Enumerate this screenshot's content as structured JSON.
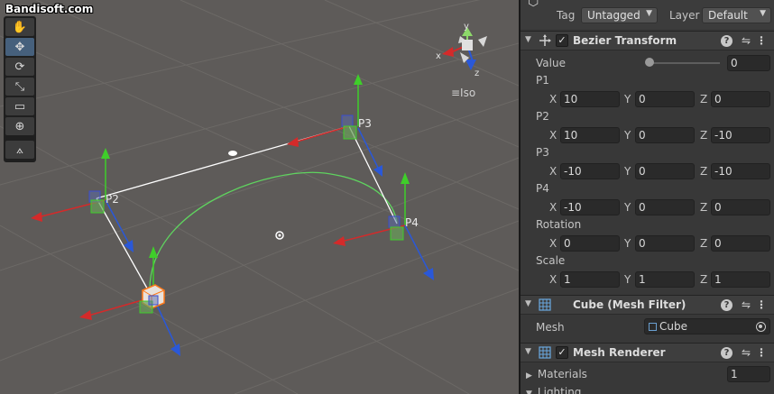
{
  "watermark": "Bandisoft.com",
  "scene": {
    "tools": [
      {
        "name": "hand-tool",
        "glyph": "✋"
      },
      {
        "name": "move-tool",
        "glyph": "✥"
      },
      {
        "name": "rotate-tool",
        "glyph": "⟳"
      },
      {
        "name": "scale-tool",
        "glyph": "⤡"
      },
      {
        "name": "rect-tool",
        "glyph": "▭"
      },
      {
        "name": "transform-tool",
        "glyph": "⊕"
      },
      {
        "name": "custom-tool",
        "glyph": "⟑"
      }
    ],
    "active_tool": 1,
    "gizmo": {
      "y_label": "y",
      "x_label": "x",
      "z_label": "z"
    },
    "projection_label": "≡Iso",
    "point_labels": {
      "p2": "P2",
      "p3": "P3",
      "p4": "P4"
    },
    "colors": {
      "curve": "#5fd35f",
      "handle": "#ffffff",
      "x_axis": "#d42a2a",
      "y_axis": "#3fce2a",
      "z_axis": "#2a58d8"
    }
  },
  "inspector": {
    "tag_label": "Tag",
    "tag_value": "Untagged",
    "layer_label": "Layer",
    "layer_value": "Default",
    "bezier": {
      "title": "Bezier Transform",
      "value_label": "Value",
      "value": "0",
      "p1_label": "P1",
      "p1": {
        "x": "10",
        "y": "0",
        "z": "0"
      },
      "p2_label": "P2",
      "p2": {
        "x": "10",
        "y": "0",
        "z": "-10"
      },
      "p3_label": "P3",
      "p3": {
        "x": "-10",
        "y": "0",
        "z": "-10"
      },
      "p4_label": "P4",
      "p4": {
        "x": "-10",
        "y": "0",
        "z": "0"
      },
      "rotation_label": "Rotation",
      "rotation": {
        "x": "0",
        "y": "0",
        "z": "0"
      },
      "scale_label": "Scale",
      "scale": {
        "x": "1",
        "y": "1",
        "z": "1"
      }
    },
    "axis_labels": {
      "x": "X",
      "y": "Y",
      "z": "Z"
    },
    "mesh_filter": {
      "title": "Cube (Mesh Filter)",
      "mesh_label": "Mesh",
      "mesh_value": "Cube"
    },
    "mesh_renderer": {
      "title": "Mesh Renderer",
      "materials_label": "Materials",
      "materials_count": "1",
      "lighting_label": "Lighting"
    }
  }
}
